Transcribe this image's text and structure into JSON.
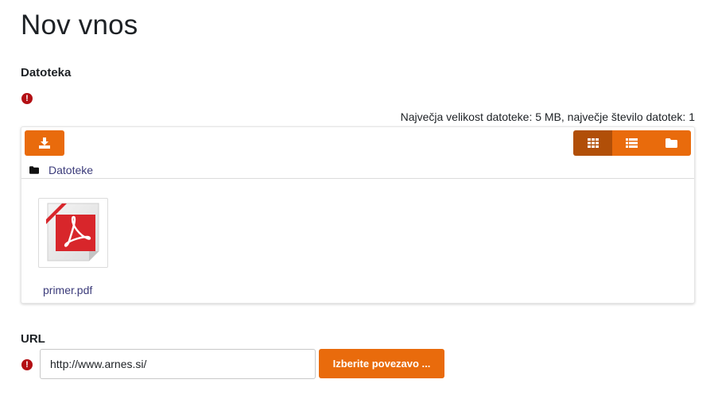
{
  "page": {
    "title": "Nov vnos"
  },
  "file_field": {
    "label": "Datoteka",
    "required_icon": "exclamation-circle-icon",
    "limits_text": "Največja velikost datoteke: 5 MB, največje število datotek: 1",
    "add_button_icon": "download-icon",
    "views": [
      {
        "name": "icons",
        "icon": "grid-icon",
        "active": true
      },
      {
        "name": "list",
        "icon": "list-icon",
        "active": false
      },
      {
        "name": "tree",
        "icon": "folder-icon",
        "active": false
      }
    ],
    "path": {
      "icon": "folder-icon",
      "label": "Datoteke"
    },
    "files": [
      {
        "name": "primer.pdf",
        "icon": "pdf-file-icon"
      }
    ]
  },
  "url_field": {
    "label": "URL",
    "required_icon": "exclamation-circle-icon",
    "value": "http://www.arnes.si/",
    "choose_button": "Izberite povezavo ..."
  },
  "colors": {
    "accent": "#e96b0c",
    "accent_active": "#b14f08",
    "required": "#b30f14",
    "link": "#3b3b7a",
    "pdf_red": "#d8262b"
  }
}
